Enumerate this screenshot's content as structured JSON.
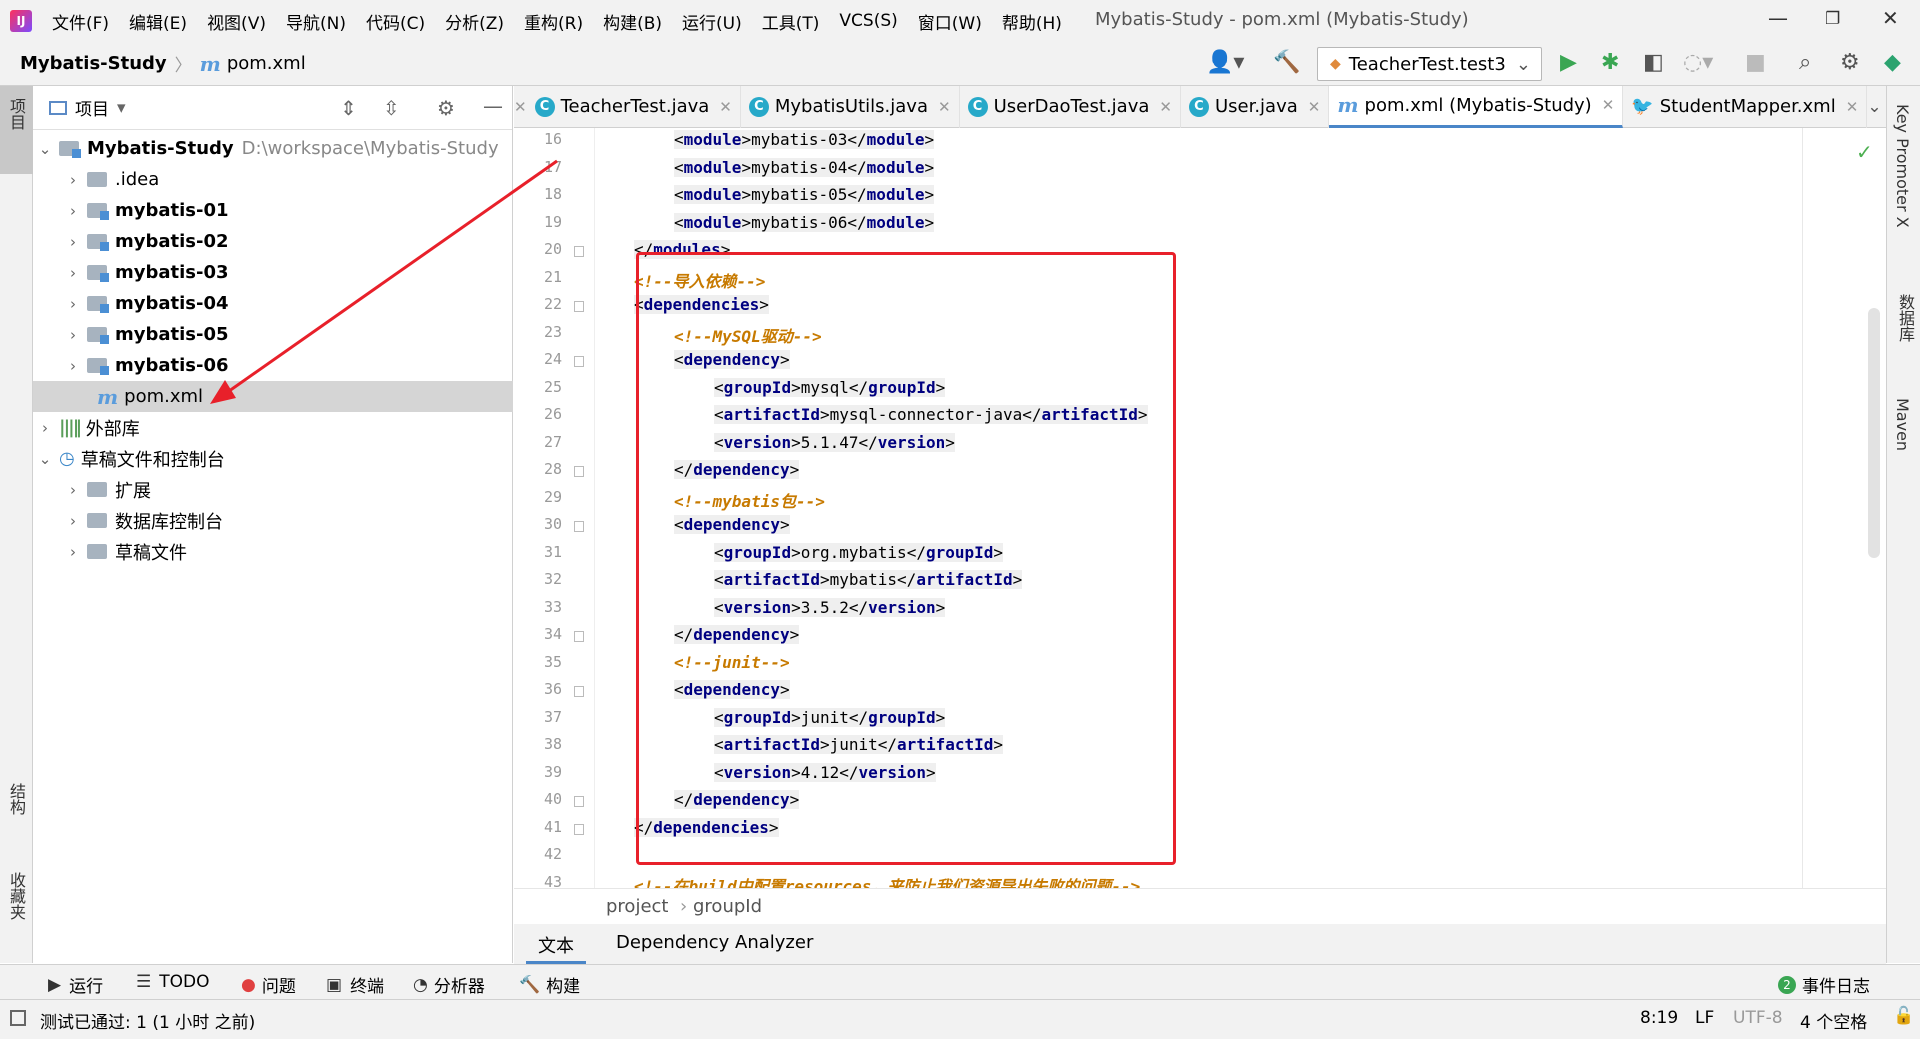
{
  "window": {
    "title": "Mybatis-Study - pom.xml (Mybatis-Study)"
  },
  "menu": [
    "文件(F)",
    "编辑(E)",
    "视图(V)",
    "导航(N)",
    "代码(C)",
    "分析(Z)",
    "重构(R)",
    "构建(B)",
    "运行(U)",
    "工具(T)",
    "VCS(S)",
    "窗口(W)",
    "帮助(H)"
  ],
  "nav": {
    "project": "Mybatis-Study",
    "file": "pom.xml",
    "run_config": "TeacherTest.test3"
  },
  "left_tabs": {
    "project": "项目",
    "structure": "结构",
    "favorites": "收藏夹"
  },
  "project_panel": {
    "title": "项目",
    "root": {
      "name": "Mybatis-Study",
      "path": "D:\\workspace\\Mybatis-Study"
    },
    "items": [
      ".idea",
      "mybatis-01",
      "mybatis-02",
      "mybatis-03",
      "mybatis-04",
      "mybatis-05",
      "mybatis-06",
      "pom.xml"
    ],
    "external": "外部库",
    "scratch": "草稿文件和控制台",
    "scratch_items": [
      "扩展",
      "数据库控制台",
      "草稿文件"
    ]
  },
  "tabs": [
    {
      "label": "TeacherTest.java",
      "icon": "class-icon"
    },
    {
      "label": "MybatisUtils.java",
      "icon": "class-icon"
    },
    {
      "label": "UserDaoTest.java",
      "icon": "class-icon"
    },
    {
      "label": "User.java",
      "icon": "class-icon"
    },
    {
      "label": "pom.xml (Mybatis-Study)",
      "icon": "maven-icon",
      "active": true
    },
    {
      "label": "StudentMapper.xml",
      "icon": "xml-icon"
    }
  ],
  "right_tabs": {
    "key_promoter": "Key Promoter X",
    "database": "数据库",
    "maven": "Maven"
  },
  "code": {
    "l16": "16",
    "l17": "17",
    "l18": "18",
    "l19": "19",
    "l20": "20",
    "l21": "21",
    "l22": "22",
    "l23": "23",
    "l24": "24",
    "l25": "25",
    "l26": "26",
    "l27": "27",
    "l28": "28",
    "l29": "29",
    "l30": "30",
    "l31": "31",
    "l32": "32",
    "l33": "33",
    "l34": "34",
    "l35": "35",
    "l36": "36",
    "l37": "37",
    "l38": "38",
    "l39": "39",
    "l40": "40",
    "l41": "41",
    "l42": "42",
    "l43": "43",
    "module": "module",
    "modules": "modules",
    "m3": "mybatis-03",
    "m4": "mybatis-04",
    "m5": "mybatis-05",
    "m6": "mybatis-06",
    "c_import": "<!--导入依赖-->",
    "dependencies": "dependencies",
    "c_mysql": "<!--MySQL驱动-->",
    "dependency": "dependency",
    "groupId": "groupId",
    "artifactId": "artifactId",
    "version": "version",
    "mysql_g": "mysql",
    "mysql_a": "mysql-connector-java",
    "mysql_v": "5.1.47",
    "c_mybatis": "<!--mybatis包-->",
    "mb_g": "org.mybatis",
    "mb_a": "mybatis",
    "mb_v": "3.5.2",
    "c_junit": "<!--junit-->",
    "ju_g": "junit",
    "ju_a": "junit",
    "ju_v": "4.12",
    "c_build": "<!--在build中配置resources，来防止我们资源导出失败的问题-->"
  },
  "breadcrumb": {
    "a": "project",
    "b": "groupId"
  },
  "bottom_tabs": {
    "text": "文本",
    "analyzer": "Dependency Analyzer"
  },
  "toolwindows": {
    "run": "运行",
    "todo": "TODO",
    "problems": "问题",
    "terminal": "终端",
    "profiler": "分析器",
    "build": "构建",
    "event_log": "事件日志",
    "event_count": "2"
  },
  "status": {
    "message": "测试已通过: 1 (1 小时 之前)",
    "position": "8:19",
    "line_sep": "LF",
    "encoding": "UTF-8",
    "indent": "4 个空格"
  },
  "colors": {
    "annotation_box": "#e8202a",
    "arrow": "#e8202a",
    "tag": "#000080",
    "comment": "#c77a00"
  }
}
